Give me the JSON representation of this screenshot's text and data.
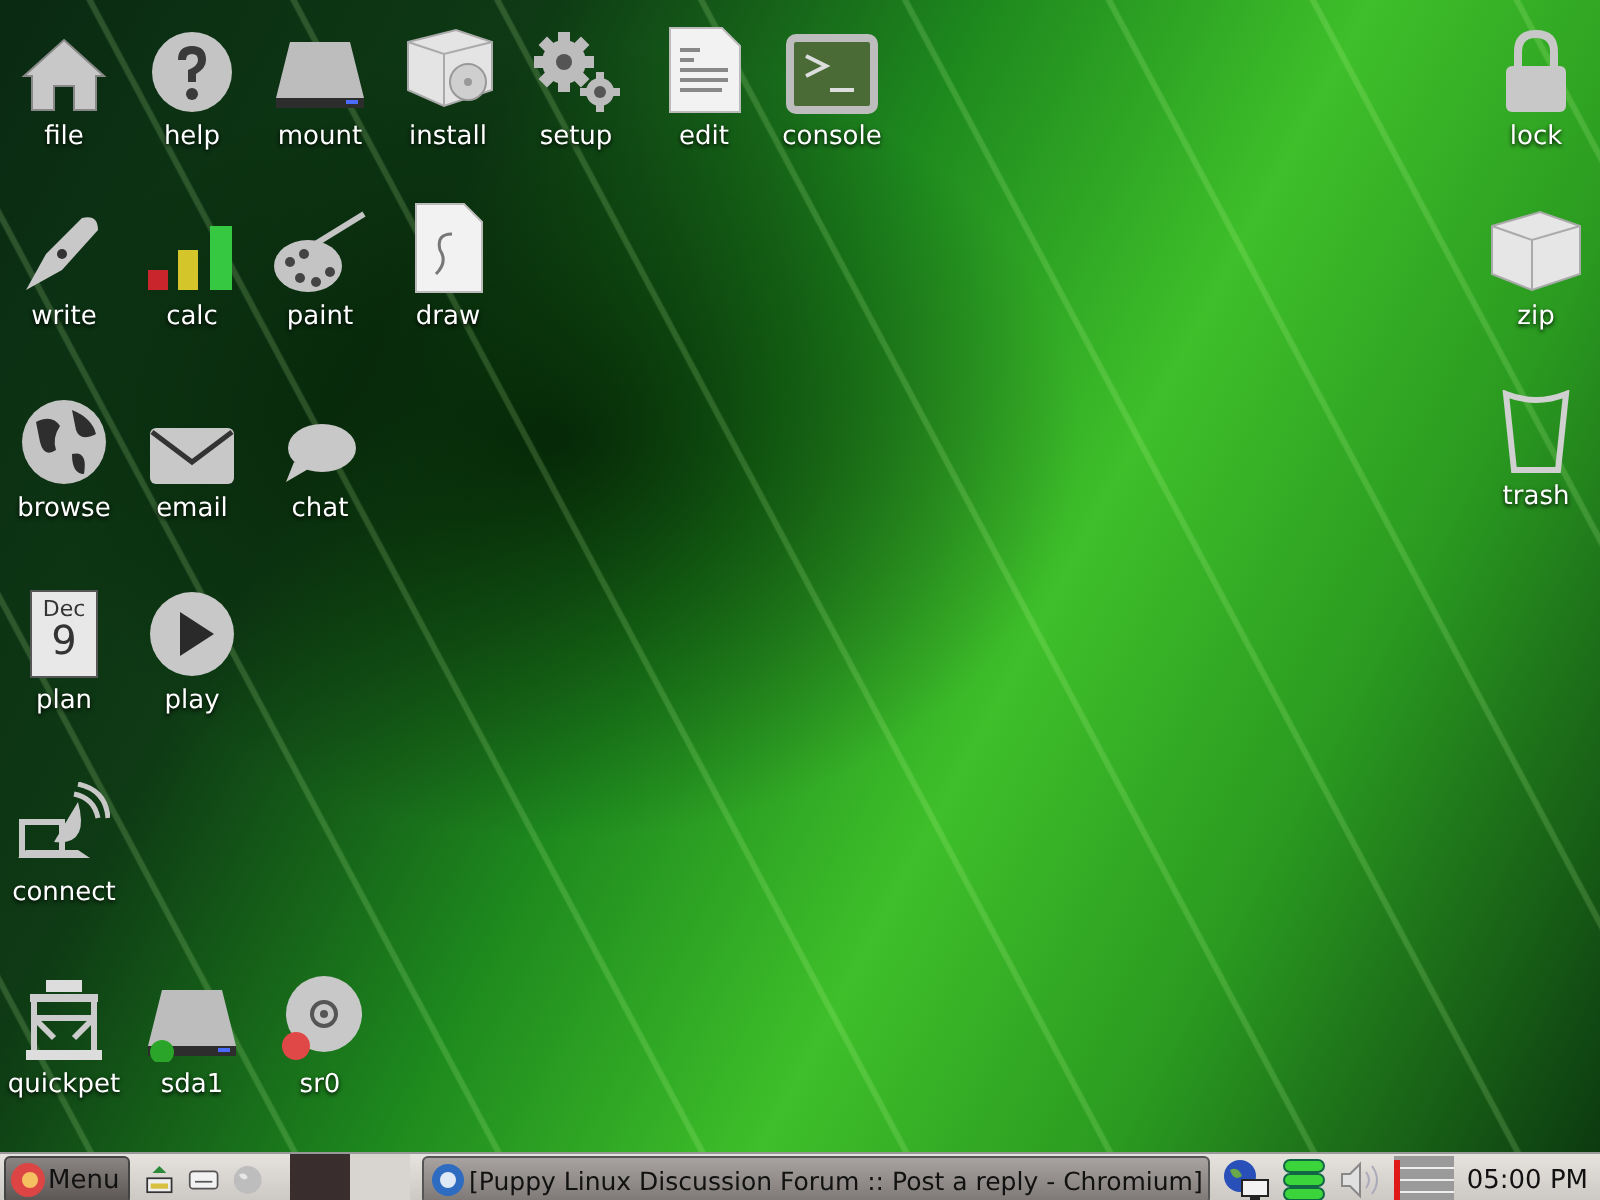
{
  "desktop": {
    "left_rows": [
      [
        {
          "label": "file",
          "kind": "home"
        },
        {
          "label": "help",
          "kind": "help"
        },
        {
          "label": "mount",
          "kind": "drive"
        },
        {
          "label": "install",
          "kind": "package"
        },
        {
          "label": "setup",
          "kind": "gears"
        },
        {
          "label": "edit",
          "kind": "document"
        },
        {
          "label": "console",
          "kind": "terminal"
        }
      ],
      [
        {
          "label": "write",
          "kind": "pen"
        },
        {
          "label": "calc",
          "kind": "bars"
        },
        {
          "label": "paint",
          "kind": "palette"
        },
        {
          "label": "draw",
          "kind": "drawing"
        }
      ],
      [
        {
          "label": "browse",
          "kind": "globe"
        },
        {
          "label": "email",
          "kind": "mail"
        },
        {
          "label": "chat",
          "kind": "speech"
        }
      ],
      [
        {
          "label": "plan",
          "kind": "calendar",
          "month": "Dec",
          "day": "9"
        },
        {
          "label": "play",
          "kind": "play"
        }
      ],
      [
        {
          "label": "connect",
          "kind": "satellite"
        }
      ],
      [
        {
          "label": "quickpet",
          "kind": "quickpet"
        },
        {
          "label": "sda1",
          "kind": "drive",
          "color": "#2aa52a"
        },
        {
          "label": "sr0",
          "kind": "disc",
          "color": "#e04848"
        }
      ]
    ],
    "right_column": [
      {
        "label": "lock",
        "kind": "lock"
      },
      {
        "label": "zip",
        "kind": "box"
      },
      {
        "label": "trash",
        "kind": "trash"
      }
    ]
  },
  "taskbar": {
    "menu_label": "Menu",
    "tasks": [
      {
        "title": "[Puppy Linux Discussion Forum :: Post a reply - Chromium]"
      }
    ],
    "clock": "05:00 PM"
  }
}
